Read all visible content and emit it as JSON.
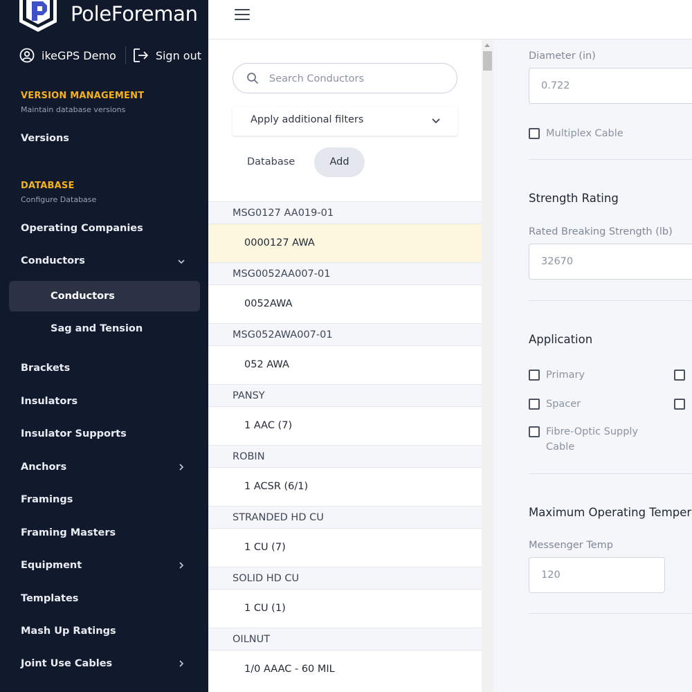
{
  "app": {
    "name": "PoleForeman"
  },
  "user": {
    "name": "ikeGPS Demo",
    "signout_label": "Sign out"
  },
  "sidebar": {
    "version_section": {
      "title": "VERSION MANAGEMENT",
      "subtitle": "Maintain database versions",
      "items": [
        {
          "label": "Versions"
        }
      ]
    },
    "database_section": {
      "title": "DATABASE",
      "subtitle": "Configure Database"
    },
    "items": [
      {
        "label": "Operating Companies"
      },
      {
        "label": "Conductors"
      },
      {
        "label": "Conductors"
      },
      {
        "label": "Sag and Tension"
      },
      {
        "label": "Brackets"
      },
      {
        "label": "Insulators"
      },
      {
        "label": "Insulator Supports"
      },
      {
        "label": "Anchors"
      },
      {
        "label": "Framings"
      },
      {
        "label": "Framing Masters"
      },
      {
        "label": "Equipment"
      },
      {
        "label": "Templates"
      },
      {
        "label": "Mash Up Ratings"
      },
      {
        "label": "Joint Use Cables"
      }
    ]
  },
  "list_panel": {
    "search_placeholder": "Search Conductors",
    "filters_label": "Apply additional filters",
    "tabs": [
      {
        "label": "Database"
      },
      {
        "label": "Add"
      }
    ],
    "groups": [
      {
        "header": "MSG0127 AA019-01",
        "item": "0000127 AWA"
      },
      {
        "header": "MSG0052AA007-01",
        "item": "0052AWA"
      },
      {
        "header": "MSG052AWA007-01",
        "item": "052 AWA"
      },
      {
        "header": "PANSY",
        "item": "1 AAC (7)"
      },
      {
        "header": "ROBIN",
        "item": "1 ACSR (6/1)"
      },
      {
        "header": "STRANDED HD CU",
        "item": "1 CU (7)"
      },
      {
        "header": "SOLID HD CU",
        "item": "1 CU (1)"
      },
      {
        "header": "OILNUT",
        "item": "1/0 AAAC - 60 MIL"
      }
    ]
  },
  "detail": {
    "diameter": {
      "label": "Diameter (in)",
      "value": "0.722"
    },
    "multiplex_label": "Multiplex Cable",
    "strength": {
      "title": "Strength Rating",
      "label": "Rated Breaking Strength (lb)",
      "value": "32670"
    },
    "application": {
      "title": "Application",
      "primary": "Primary",
      "spacer": "Spacer",
      "fibre": "Fibre-Optic Supply Cable"
    },
    "temperature": {
      "title": "Maximum Operating Temperature",
      "label": "Messenger Temp",
      "value": "120"
    }
  },
  "colors": {
    "sidebar_bg": "#111a2c",
    "accent": "#f6b21b",
    "selected_row": "#fdf7df"
  }
}
